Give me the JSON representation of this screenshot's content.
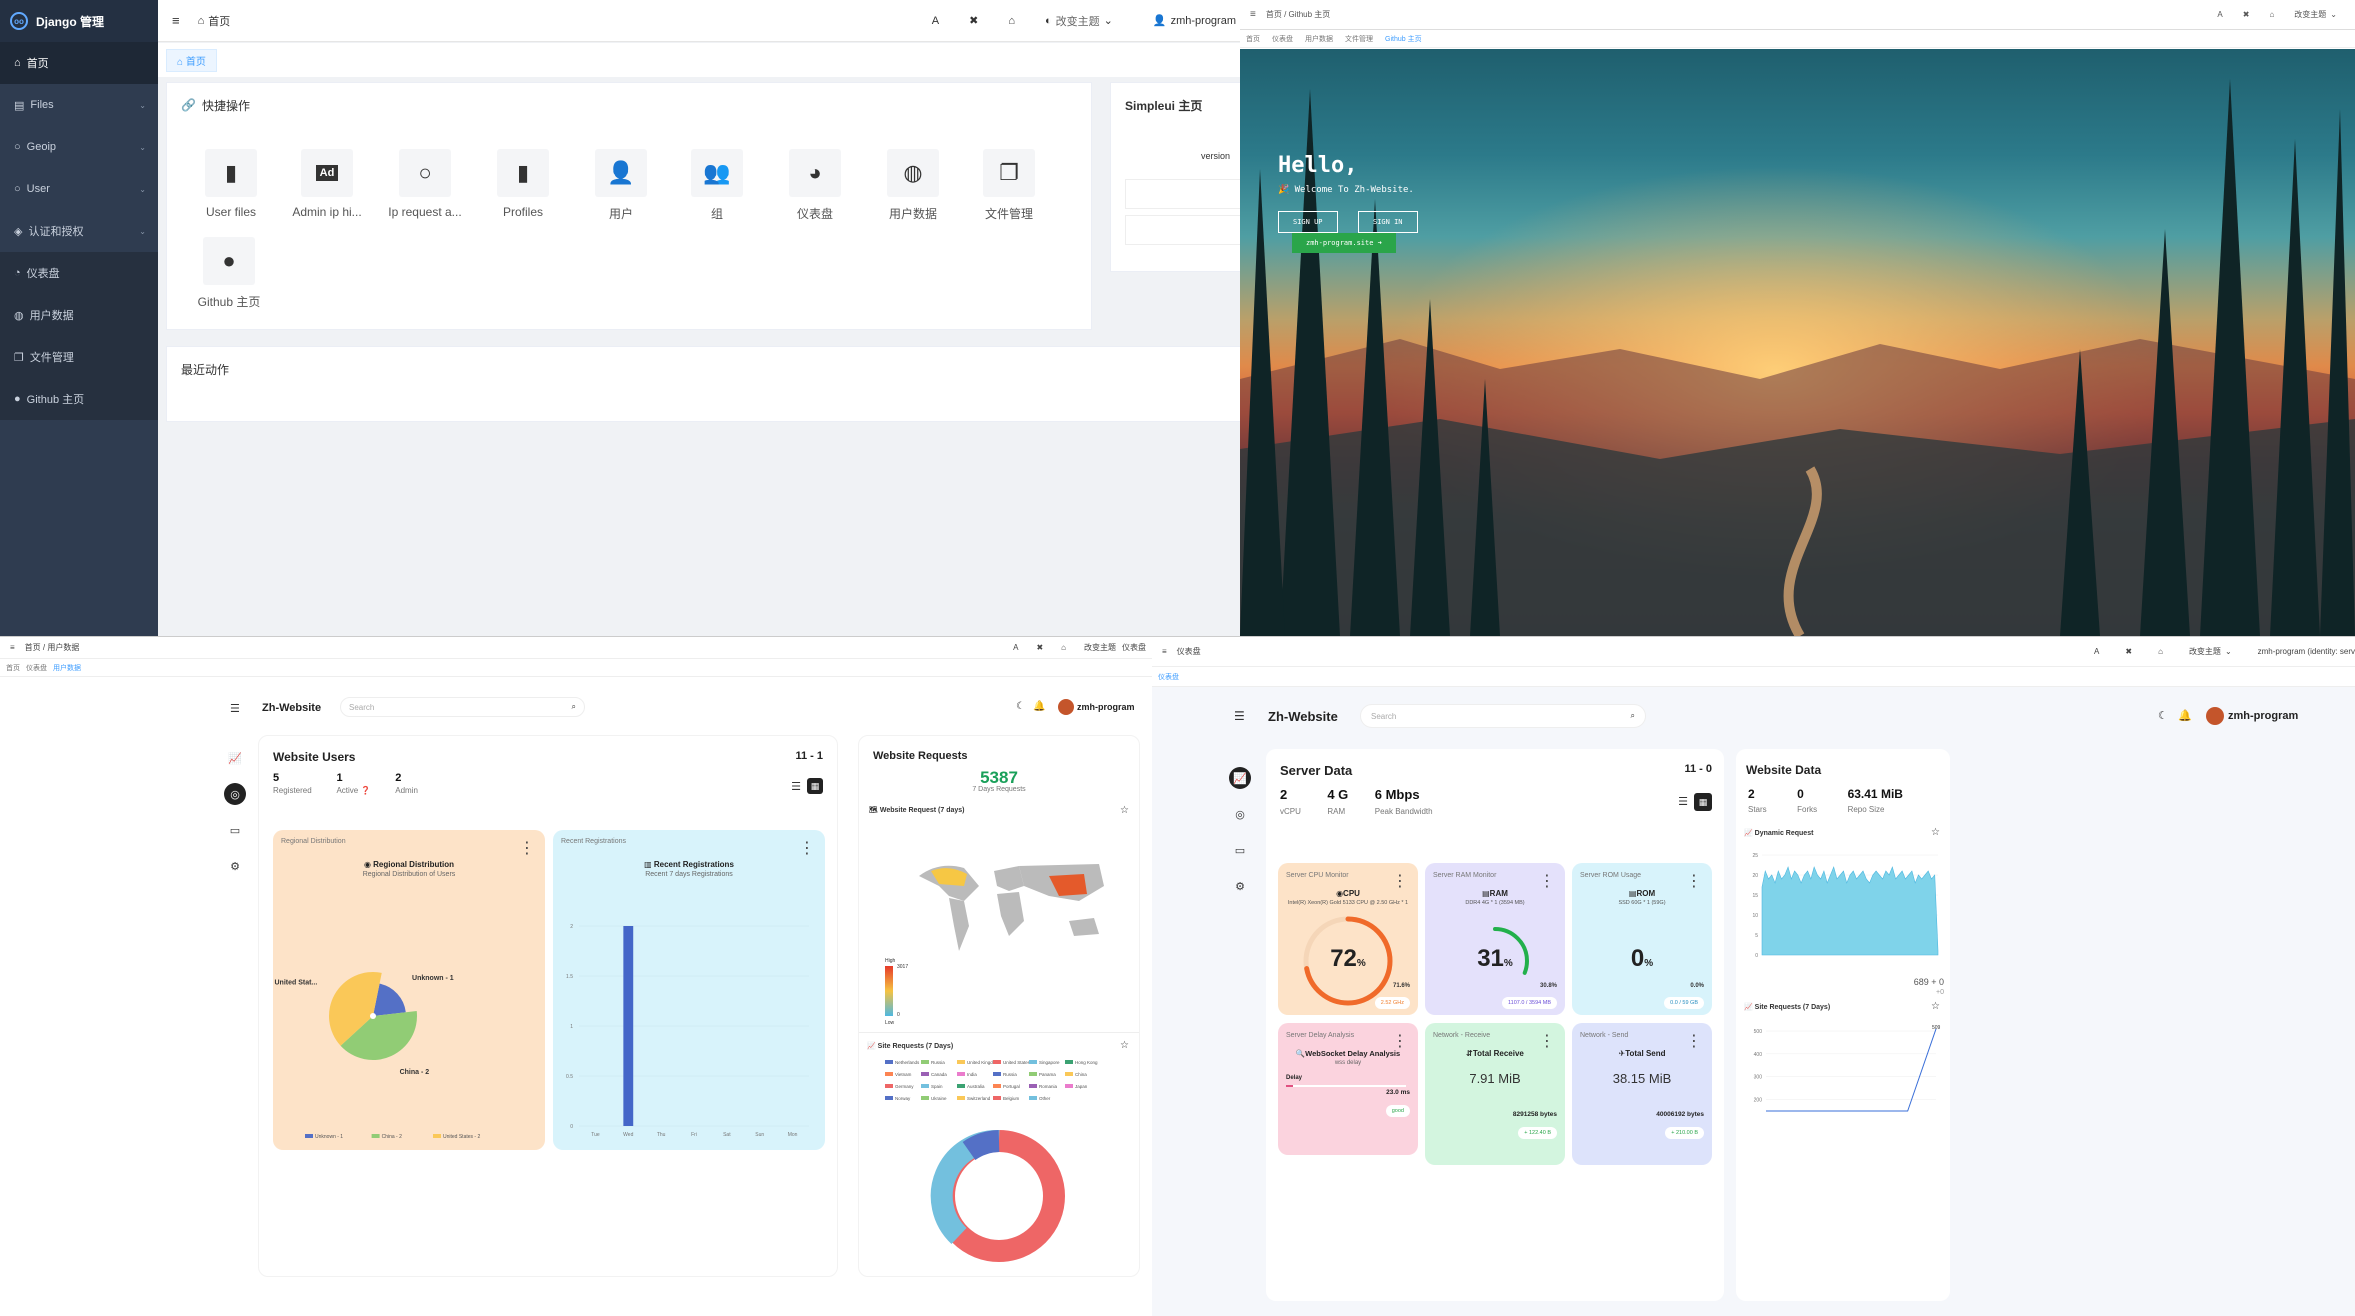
{
  "q1": {
    "brand": "Django 管理",
    "menu": [
      {
        "label": "首页",
        "icon": "home-icon"
      },
      {
        "label": "Files",
        "icon": "file-icon"
      },
      {
        "label": "Geoip",
        "icon": "circle-icon"
      },
      {
        "label": "User",
        "icon": "circle-icon"
      },
      {
        "label": "认证和授权",
        "icon": "shield-icon"
      },
      {
        "label": "仪表盘",
        "icon": "gauge-icon"
      },
      {
        "label": "用户数据",
        "icon": "globe-icon"
      },
      {
        "label": "文件管理",
        "icon": "copy-icon"
      },
      {
        "label": "Github 主页",
        "icon": "github-icon"
      }
    ],
    "breadcrumb": "首页",
    "theme_label": "改变主题",
    "user": "zmh-program",
    "tab_home": "首页",
    "quick_title": "快捷操作",
    "quick": [
      {
        "label": "User files",
        "icon": "file-icon"
      },
      {
        "label": "Admin ip hi...",
        "icon": "ad-icon"
      },
      {
        "label": "Ip request a...",
        "icon": "circle-icon"
      },
      {
        "label": "Profiles",
        "icon": "file-icon"
      },
      {
        "label": "用户",
        "icon": "user-icon"
      },
      {
        "label": "组",
        "icon": "users-icon"
      },
      {
        "label": "仪表盘",
        "icon": "gauge-icon"
      },
      {
        "label": "用户数据",
        "icon": "globe-icon"
      },
      {
        "label": "文件管理",
        "icon": "copy-icon"
      },
      {
        "label": "Github 主页",
        "icon": "github-icon"
      }
    ],
    "simpleui_title": "Simpleui 主页",
    "version_label": "version",
    "recent_title": "最近动作"
  },
  "q2": {
    "breadcrumb": "首页 / Github 主页",
    "tabs": [
      "首页",
      "仪表盘",
      "用户数据",
      "文件管理",
      "Github 主页"
    ],
    "theme_label": "改变主题",
    "hello": "Hello,",
    "welcome": "Welcome To Zh-Website.",
    "sign_up": "SIGN UP",
    "sign_in": "SIGN IN",
    "site_button": "zmh-program.site"
  },
  "q3": {
    "breadcrumb": "首页 / 用户数据",
    "theme_label": "改变主题",
    "user_breadcrumb": "仪表盘",
    "tabs": [
      "首页",
      "仪表盘",
      "用户数据"
    ],
    "brand": "Zh-Website",
    "search_placeholder": "Search",
    "user": "zmh-program",
    "users_title": "Website Users",
    "users_date": "11 - 1",
    "stats": [
      {
        "value": "5",
        "label": "Registered"
      },
      {
        "value": "1",
        "label": "Active"
      },
      {
        "value": "2",
        "label": "Admin"
      }
    ],
    "region_header": "Regional Distribution",
    "region_title": "Regional Distribution",
    "region_sub": "Regional Distribution of Users",
    "recent_header": "Recent Registrations",
    "recent_title": "Recent Registrations",
    "recent_sub": "Recent 7 days Registrations",
    "requests_title": "Website Requests",
    "requests_value": "5387",
    "requests_sub": "7 Days Requests",
    "map_title": "Website Request (7 days)",
    "map_high": "High",
    "map_low": "Low",
    "map_max": "3017",
    "map_min": "0",
    "site_req_title": "Site Requests (7 Days)",
    "countries": [
      "Netherlands",
      "Russia",
      "United Kingdom",
      "United States",
      "Singapore",
      "Hong Kong",
      "Vietnam",
      "Canada",
      "India",
      "Russia",
      "Panama",
      "China",
      "Germany",
      "Spain",
      "Australia",
      "Portugal",
      "Romania",
      "Japan",
      "Norway",
      "Ukraine",
      "Switzerland",
      "Belgium",
      "Other"
    ]
  },
  "q4": {
    "breadcrumb": "仪表盘",
    "theme_label": "改变主题",
    "user_top": "zmh-program (identity: serv",
    "tab": "仪表盘",
    "brand": "Zh-Website",
    "search_placeholder": "Search",
    "user": "zmh-program",
    "server_title": "Server Data",
    "server_date": "11 - 0",
    "server_stats": [
      {
        "value": "2",
        "label": "vCPU"
      },
      {
        "value": "4 G",
        "label": "RAM"
      },
      {
        "value": "6 Mbps",
        "label": "Peak Bandwidth"
      }
    ],
    "cpu": {
      "header": "Server CPU Monitor",
      "title": "CPU",
      "desc": "Intel(R) Xeon(R) Gold 5133 CPU @ 2.50 GHz * 1",
      "value": "72",
      "unit": "%",
      "right": "71.6%",
      "pill": "2.52 GHz",
      "fraction": 0.72
    },
    "ram": {
      "header": "Server RAM Monitor",
      "title": "RAM",
      "desc": "DDR4 4G * 1 (3594 MB)",
      "value": "31",
      "unit": "%",
      "right": "30.8%",
      "pill": "1107.0 / 3594 MB",
      "fraction": 0.31
    },
    "rom": {
      "header": "Server ROM Usage",
      "title": "ROM",
      "desc": "SSD 60G * 1 (59G)",
      "value": "0",
      "unit": "%",
      "right": "0.0%",
      "pill": "0.0 / 59 GB"
    },
    "delay": {
      "header": "Server Delay Analysis",
      "title": "WebSocket Delay Analysis",
      "sub": "wss delay",
      "label": "Delay",
      "value": "23.0 ms",
      "pill": "good"
    },
    "recv": {
      "header": "Network - Receive",
      "title": "Total Receive",
      "value": "7.91 MiB",
      "bytes": "8291258 bytes",
      "pill": "+ 122.40 B"
    },
    "send": {
      "header": "Network - Send",
      "title": "Total Send",
      "value": "38.15 MiB",
      "bytes": "40006192 bytes",
      "pill": "+ 210.00 B"
    },
    "web_title": "Website Data",
    "web_stats": [
      {
        "value": "2",
        "label": "Stars"
      },
      {
        "value": "0",
        "label": "Forks"
      },
      {
        "value": "63.41 MiB",
        "label": "Repo Size"
      }
    ],
    "dyn_title": "Dynamic Request",
    "dyn_readout1": "689 + 0",
    "dyn_readout2": "+0",
    "site_title": "Site Requests (7 Days)"
  },
  "chart_data": [
    {
      "type": "pie",
      "title": "Regional Distribution",
      "categories": [
        "Unknown",
        "China",
        "United States"
      ],
      "values": [
        1,
        2,
        2
      ],
      "labels": [
        "Unknown - 1",
        "China - 2",
        "United Stat..."
      ],
      "legend": [
        "Unknown - 1",
        "China - 2",
        "United States - 2"
      ],
      "colors": [
        "#5470c6",
        "#91cc75",
        "#fac858"
      ]
    },
    {
      "type": "bar",
      "title": "Recent Registrations",
      "categories": [
        "Tue",
        "Wed",
        "Thu",
        "Fri",
        "Sat",
        "Sun",
        "Mon"
      ],
      "values": [
        0,
        2,
        0,
        0,
        0,
        0,
        0
      ],
      "ylim": [
        0,
        2
      ],
      "yticks": [
        "0",
        "0.5",
        "1",
        "1.5",
        "2"
      ]
    },
    {
      "type": "area",
      "title": "Dynamic Request",
      "ylim": [
        0,
        25
      ],
      "yticks": [
        "0",
        "5",
        "10",
        "15",
        "20",
        "25"
      ],
      "values": [
        17,
        21,
        19,
        20,
        18,
        21,
        19,
        20,
        22,
        19,
        21,
        20,
        18,
        20,
        21,
        19,
        22,
        20,
        19,
        21,
        18,
        20,
        22,
        19,
        20,
        21,
        18,
        20,
        21,
        19,
        20,
        21,
        19,
        18,
        20,
        21,
        20,
        19,
        21,
        20,
        22,
        19,
        20,
        21,
        19,
        20,
        21,
        18,
        20,
        19,
        20,
        21,
        19,
        20,
        1
      ]
    },
    {
      "type": "line",
      "title": "Site Requests (7 Days)",
      "ylim": [
        0,
        500
      ],
      "yticks": [
        "200",
        "300",
        "400",
        "500"
      ],
      "values": [
        0,
        0,
        0,
        0,
        0,
        0,
        509
      ],
      "peak_label": "509"
    }
  ]
}
